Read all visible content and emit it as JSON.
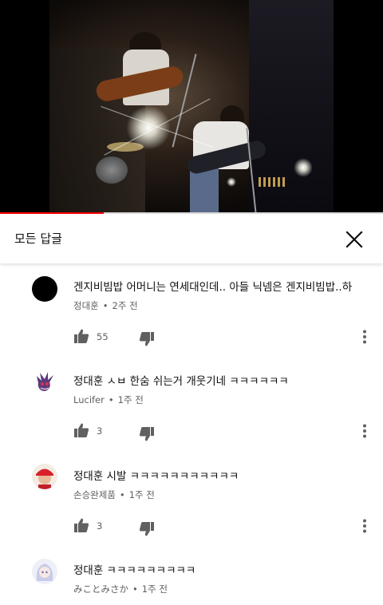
{
  "video": {
    "progress_percent": 27
  },
  "panel": {
    "title": "모든 답글"
  },
  "comments": [
    {
      "avatar": "black-circle-avatar",
      "text": "겐지비빔밥 어머니는 연세대인데.. 아들 닉넴은 겐지비빔밥..하",
      "author": "정대훈",
      "time": "2주 전",
      "likes": "55"
    },
    {
      "avatar": "purple-creature-avatar",
      "text": "정대훈 ㅅㅂ 한숨 쉬는거 개웃기네 ㅋㅋㅋㅋㅋㅋ",
      "author": "Lucifer",
      "time": "1주 전",
      "likes": "3"
    },
    {
      "avatar": "red-hat-person-avatar",
      "text": "정대훈 시발 ㅋㅋㅋㅋㅋㅋㅋㅋㅋㅋㅋ",
      "author": "손승완제품",
      "time": "1주 전",
      "likes": "3"
    },
    {
      "avatar": "anime-girl-avatar",
      "text": "정대훈 ㅋㅋㅋㅋㅋㅋㅋㅋㅋ",
      "author": "みことみさか",
      "time": "1주 전",
      "likes": ""
    }
  ]
}
